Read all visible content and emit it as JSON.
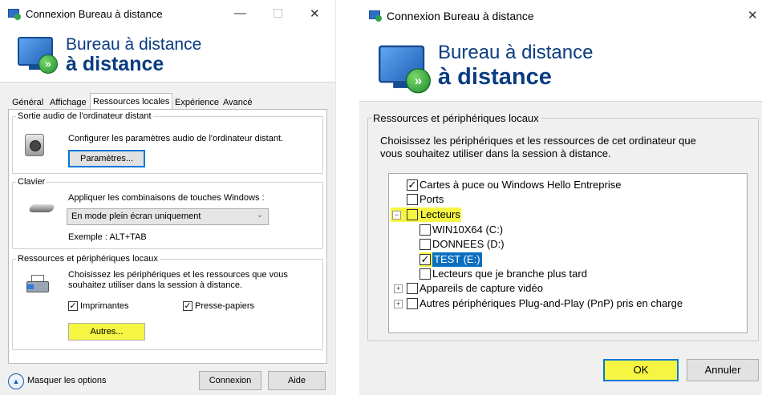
{
  "left_window": {
    "title": "Connexion Bureau à distance",
    "controls": {
      "minimize": "—",
      "maximize": "☐",
      "close": "✕"
    },
    "banner": {
      "line1": "Bureau à distance",
      "line2": "à distance"
    },
    "tabs": [
      {
        "label": "Général",
        "active": false
      },
      {
        "label": "Affichage",
        "active": false
      },
      {
        "label": "Ressources locales",
        "active": true
      },
      {
        "label": "Expérience",
        "active": false
      },
      {
        "label": "Avancé",
        "active": false
      }
    ],
    "audio_group": {
      "legend": "Sortie audio de l'ordinateur distant",
      "text": "Configurer les paramètres audio de l'ordinateur distant.",
      "button": "Paramètres..."
    },
    "keyboard_group": {
      "legend": "Clavier",
      "text": "Appliquer les combinaisons de touches Windows :",
      "select_value": "En mode plein écran uniquement",
      "example": "Exemple : ALT+TAB"
    },
    "resources_group": {
      "legend": "Ressources et périphériques locaux",
      "text_line1": "Choisissez les périphériques et les ressources que vous",
      "text_line2": "souhaitez utiliser dans la session à distance.",
      "printers_label": "Imprimantes",
      "clipboard_label": "Presse-papiers",
      "more_button": "Autres..."
    },
    "footer": {
      "hide_options": "Masquer les options",
      "connect_button": "Connexion",
      "help_button": "Aide"
    }
  },
  "right_window": {
    "title": "Connexion Bureau à distance",
    "close": "✕",
    "banner": {
      "line1": "Bureau à distance",
      "line2": "à distance"
    },
    "group_legend": "Ressources et périphériques locaux",
    "text_line1": "Choisissez les périphériques et les ressources de cet ordinateur que",
    "text_line2": "vous souhaitez utiliser dans la session à distance.",
    "tree": [
      {
        "label": "Cartes à puce ou Windows Hello Entreprise",
        "checked": true
      },
      {
        "label": "Ports",
        "checked": false
      },
      {
        "label": "Lecteurs",
        "checked": false,
        "expander": "−"
      },
      {
        "label": "WIN10X64 (C:)",
        "checked": false
      },
      {
        "label": "DONNEES (D:)",
        "checked": false
      },
      {
        "label": "TEST (E:)",
        "checked": true
      },
      {
        "label": "Lecteurs que je branche plus tard",
        "checked": false
      },
      {
        "label": "Appareils de capture vidéo",
        "checked": false,
        "expander": "+"
      },
      {
        "label": "Autres périphériques Plug-and-Play (PnP) pris en charge",
        "checked": false,
        "expander": "+"
      }
    ],
    "ok_button": "OK",
    "cancel_button": "Annuler"
  }
}
